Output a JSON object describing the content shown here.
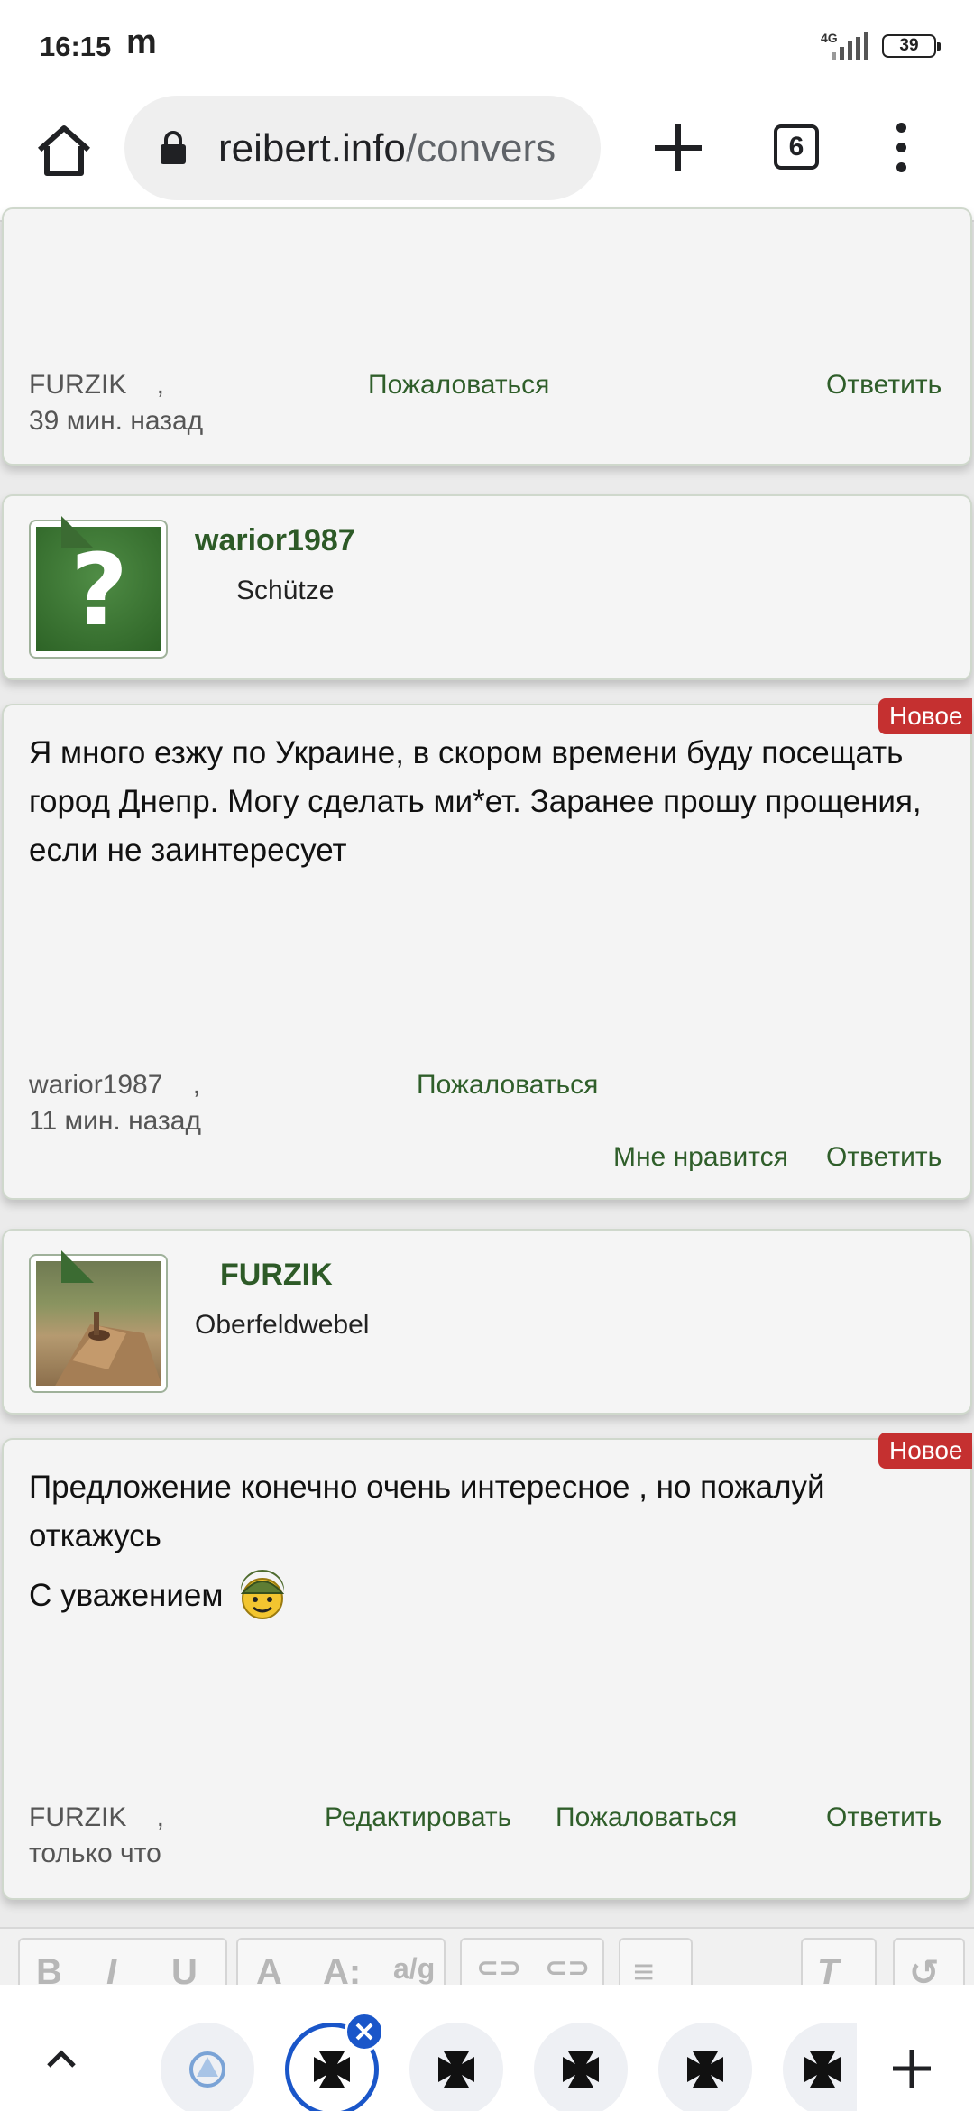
{
  "status_bar": {
    "time": "16:15",
    "carrier_icon": "m",
    "network": "4G",
    "battery": "39"
  },
  "browser": {
    "url_host": "reibert.info",
    "url_path": "/convers",
    "tab_count": "6"
  },
  "posts": [
    {
      "author": "FURZIK",
      "separator": ",",
      "time": "39 мин. назад",
      "report_label": "Пожаловаться",
      "reply_label": "Ответить"
    },
    {
      "username": "warior1987",
      "rank": "Schütze",
      "badge": "Новое",
      "text": "Я много езжу по Украине, в скором времени буду посещать город Днепр. Могу сделать ми*ет. Заранее прошу прощения, если не заинтересует",
      "author": "warior1987",
      "separator": ",",
      "time": "11 мин. назад",
      "report_label": "Пожаловаться",
      "like_label": "Мне нравится",
      "reply_label": "Ответить"
    },
    {
      "username": "FURZIK",
      "rank": "Oberfeldwebel",
      "badge": "Новое",
      "text_line1": "Предложение конечно очень интересное , но пожалуй откажусь",
      "text_line2": "С уважением",
      "author": "FURZIK",
      "separator": ",",
      "time": "только что",
      "edit_label": "Редактировать",
      "report_label": "Пожаловаться",
      "reply_label": "Ответить"
    }
  ],
  "editor_toolbar": [
    "B",
    "I",
    "U",
    "A",
    "A:",
    "a/g",
    "link",
    "unlink",
    "align",
    "Tx",
    "undo"
  ],
  "colors": {
    "accent_green": "#2f5e2a",
    "badge_red": "#c53030",
    "active_tab_blue": "#1a56c9"
  }
}
